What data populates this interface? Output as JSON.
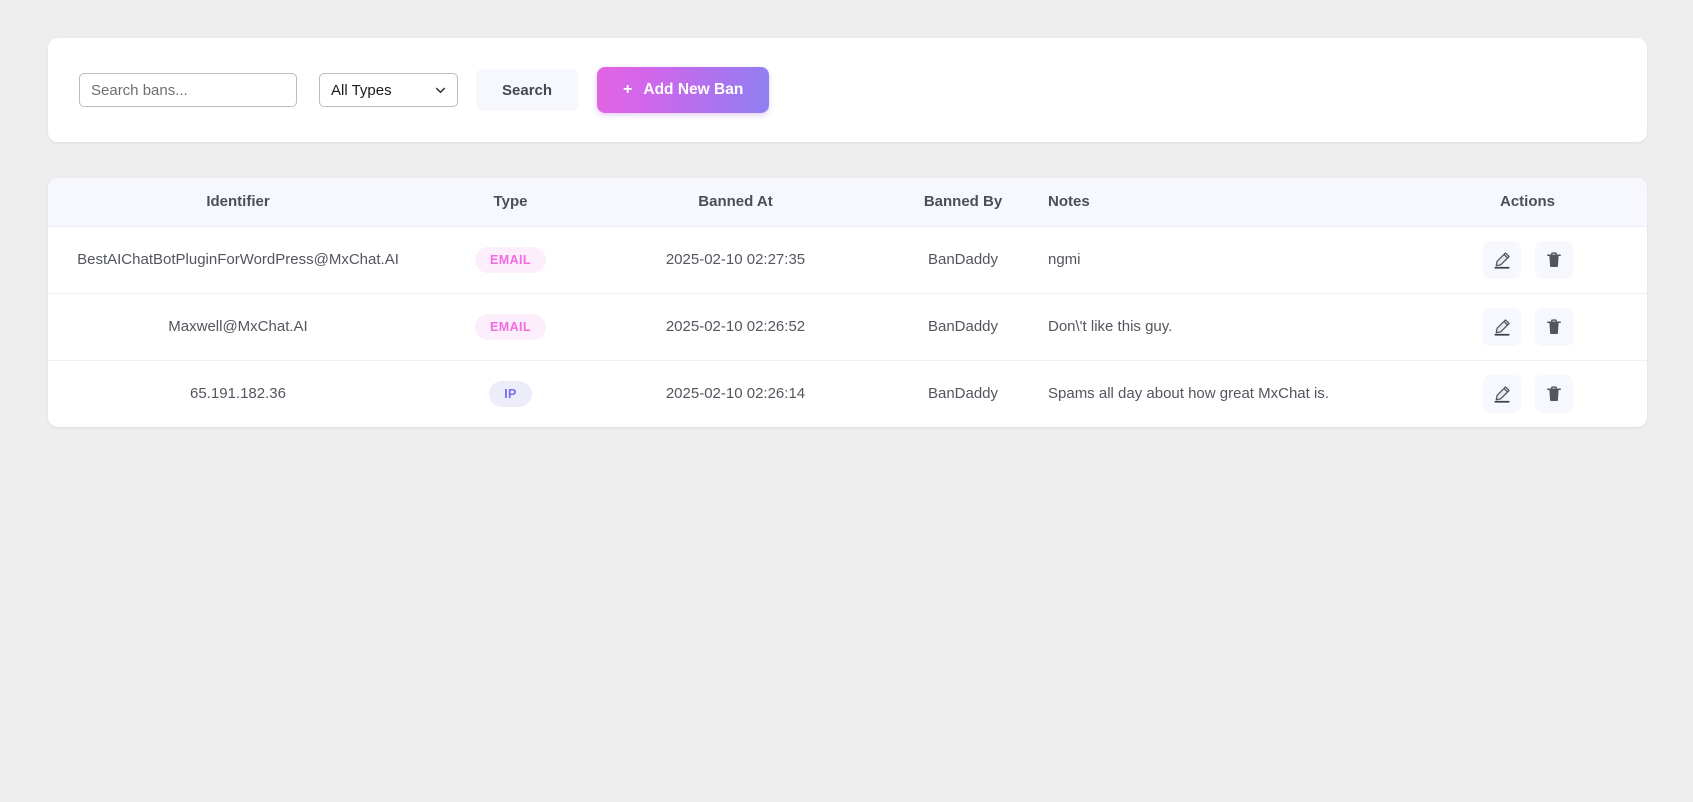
{
  "toolbar": {
    "search_placeholder": "Search bans...",
    "search_value": "",
    "type_filter_selected": "All Types",
    "type_filter_options": [
      "All Types"
    ],
    "search_button_label": "Search",
    "add_ban_plus": "+",
    "add_ban_label": "Add New Ban"
  },
  "table": {
    "columns": [
      "Identifier",
      "Type",
      "Banned At",
      "Banned By",
      "Notes",
      "Actions"
    ],
    "rows": [
      {
        "identifier": "BestAIChatBotPluginForWordPress@MxChat.AI",
        "type": "EMAIL",
        "type_style": "email",
        "banned_at": "2025-02-10 02:27:35",
        "banned_by": "BanDaddy",
        "notes": "ngmi"
      },
      {
        "identifier": "Maxwell@MxChat.AI",
        "type": "EMAIL",
        "type_style": "email",
        "banned_at": "2025-02-10 02:26:52",
        "banned_by": "BanDaddy",
        "notes": "Don\\'t like this guy."
      },
      {
        "identifier": "65.191.182.36",
        "type": "IP",
        "type_style": "ip",
        "banned_at": "2025-02-10 02:26:14",
        "banned_by": "BanDaddy",
        "notes": "Spams all day about how great MxChat is."
      }
    ]
  },
  "colors": {
    "page_background": "#efeeee",
    "card_background": "#ffffff",
    "header_background": "#f7f8fd",
    "accent_gradient_start": "#e264e2",
    "accent_gradient_end": "#8d81f0",
    "badge_email_bg": "#fdeefb",
    "badge_email_text": "#f06ce0",
    "badge_ip_bg": "#edecfb",
    "badge_ip_text": "#7b6cf0"
  },
  "icons": {
    "chevron_down": "chevron-down-icon",
    "edit": "edit-pencil-icon",
    "delete": "trash-icon"
  }
}
